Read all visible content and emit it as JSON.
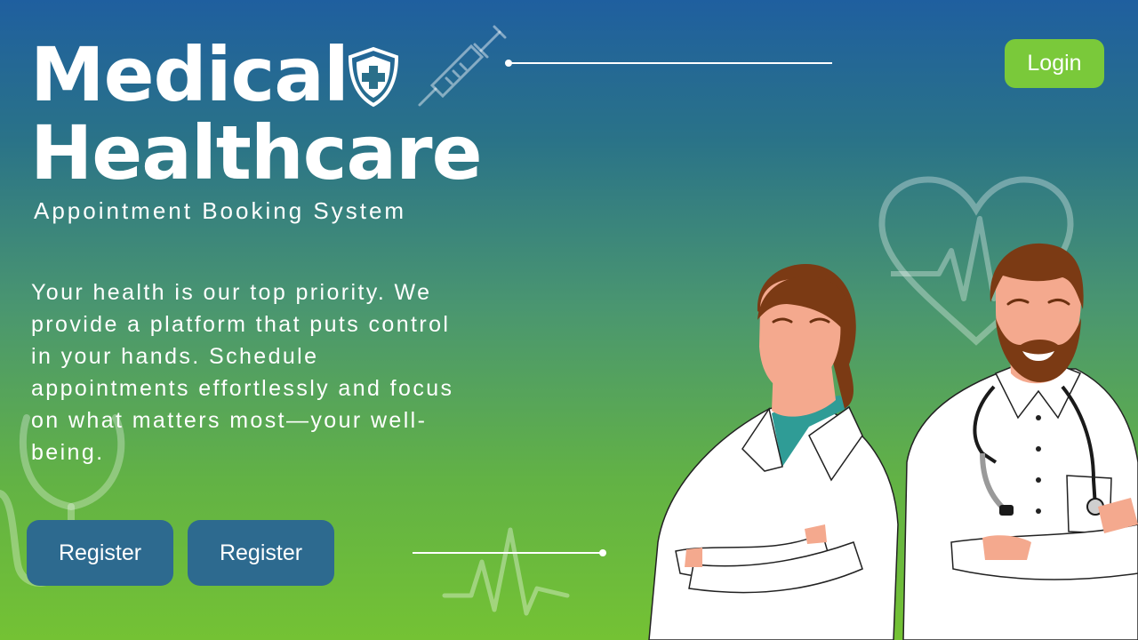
{
  "header": {
    "title_line1": "Medical",
    "title_line2": "Healthcare",
    "subtitle": "Appointment Booking System",
    "login_label": "Login"
  },
  "main": {
    "description": "Your health is our top priority. We provide a platform that puts control in your hands. Schedule appointments effortlessly and focus on what matters most—your well-being.",
    "buttons": [
      {
        "label": "Register"
      },
      {
        "label": "Register"
      }
    ]
  },
  "icons": {
    "shield": "shield-cross-icon",
    "syringe": "syringe-icon",
    "heart": "heartbeat-icon",
    "stethoscope": "stethoscope-icon",
    "pulse": "pulse-line-icon"
  },
  "colors": {
    "gradient_top": "#1f5f9f",
    "gradient_bottom": "#74c234",
    "register_button": "#2d6a8f",
    "login_button": "#7ac93a"
  }
}
